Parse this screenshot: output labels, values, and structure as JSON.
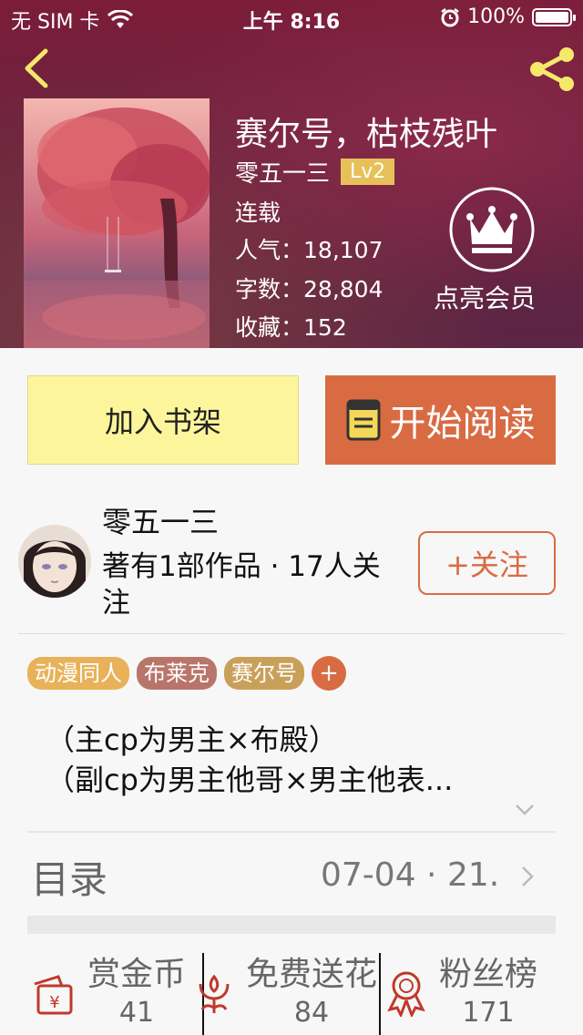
{
  "status_bar": {
    "carrier": "无 SIM 卡",
    "time": "上午 8:16",
    "battery": "100%",
    "battery_level": 1.0
  },
  "book": {
    "title": "赛尔号，枯枝残叶",
    "author": "零五一三",
    "level": "Lv2",
    "status": "连载",
    "popularity_label": "人气：",
    "popularity": "18,107",
    "words_label": "字数：",
    "words": "28,804",
    "favorites_label": "收藏：",
    "favorites": "152"
  },
  "vip": {
    "label": "点亮会员"
  },
  "actions": {
    "add_shelf": "加入书架",
    "start_read": "开始阅读"
  },
  "author_card": {
    "name": "零五一三",
    "works": "著有1部作品 · 17人关注",
    "follow": "+关注"
  },
  "tags": [
    {
      "label": "动漫同人",
      "color": "#e8b25a"
    },
    {
      "label": "布莱克",
      "color": "#b9756a"
    },
    {
      "label": "赛尔号",
      "color": "#c9a05a"
    }
  ],
  "tag_add": "+",
  "description": [
    "（主cp为男主×布殿）",
    "（副cp为男主他哥×男主他表..."
  ],
  "toc": {
    "label": "目录",
    "date": "07-04 · 21."
  },
  "stats": [
    {
      "label": "赏金币",
      "value": "41",
      "icon": "red-envelope-icon"
    },
    {
      "label": "免费送花",
      "value": "84",
      "icon": "flower-icon"
    },
    {
      "label": "粉丝榜",
      "value": "171",
      "icon": "ribbon-award-icon"
    }
  ],
  "colors": {
    "accent": "#d96b43",
    "shelf_button": "#fcf59b",
    "level_badge": "#e8c05a",
    "header_bg": "#6b1f3d"
  }
}
